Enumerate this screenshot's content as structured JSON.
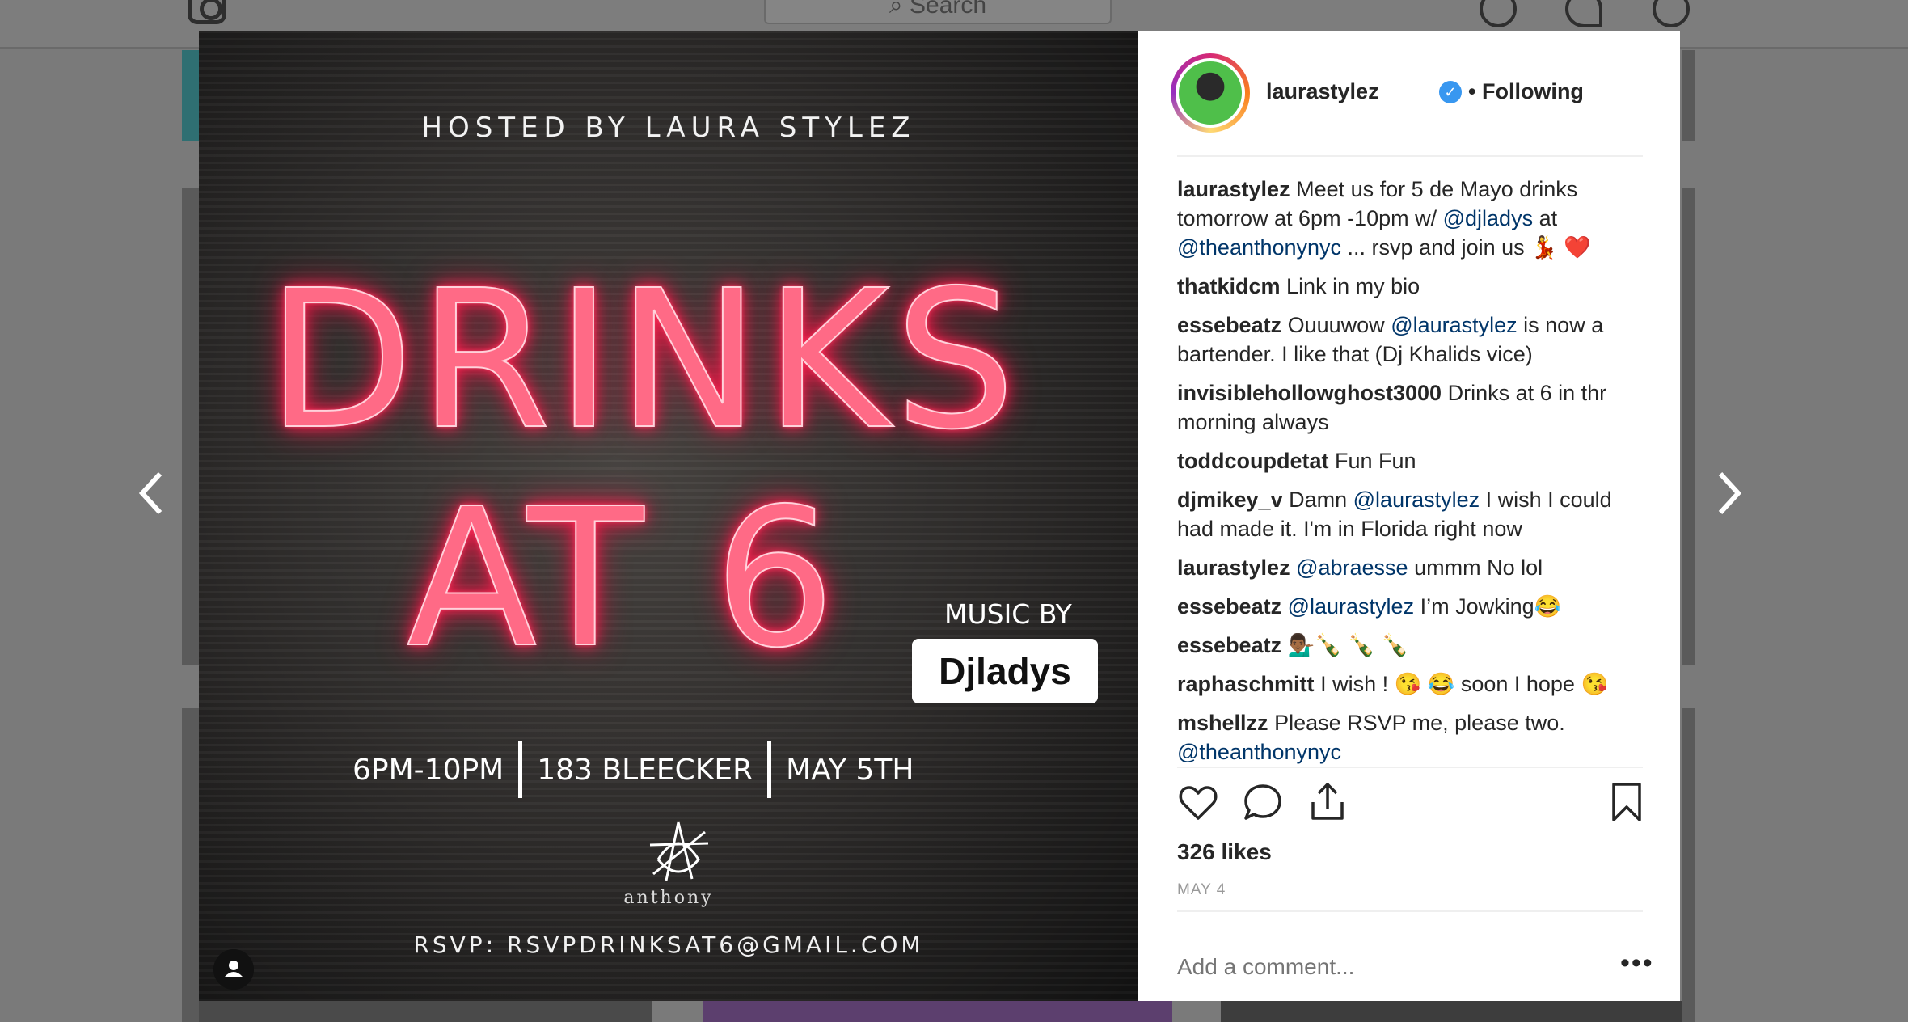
{
  "background": {
    "search_placeholder": "Search"
  },
  "post": {
    "image": {
      "hosted": "HOSTED BY LAURA STYLEZ",
      "headline_line1": "DRINKS",
      "headline_line2": "AT 6",
      "music_by": "MUSIC BY",
      "dj": "Djladys",
      "time": "6PM-10PM",
      "address": "183 BLEECKER",
      "date": "MAY 5TH",
      "venue_logo_text": "anthony",
      "rsvp": "RSVP: RSVPDRINKSAT6@GMAIL.COM"
    },
    "header": {
      "username": "laurastylez",
      "verified_glyph": "✓",
      "following": "• Following"
    },
    "comments": [
      {
        "user": "laurastylez",
        "parts": [
          {
            "t": "Meet us for 5 de Mayo drinks tomorrow at 6pm -10pm w/ "
          },
          {
            "t": "@djladys",
            "mention": true
          },
          {
            "t": " at "
          },
          {
            "t": "@theanthonynyc",
            "mention": true
          },
          {
            "t": " ... rsvp and join us 💃 ❤️"
          }
        ]
      },
      {
        "user": "thatkidcm",
        "parts": [
          {
            "t": "Link in my bio"
          }
        ]
      },
      {
        "user": "essebeatz",
        "parts": [
          {
            "t": "Ouuuwow "
          },
          {
            "t": "@laurastylez",
            "mention": true
          },
          {
            "t": " is now a bartender. I like that (Dj Khalids vice)"
          }
        ]
      },
      {
        "user": "invisiblehollowghost3000",
        "parts": [
          {
            "t": "Drinks at 6 in thr morning always"
          }
        ]
      },
      {
        "user": "toddcoupdetat",
        "parts": [
          {
            "t": "Fun Fun"
          }
        ]
      },
      {
        "user": "djmikey_v",
        "parts": [
          {
            "t": "Damn "
          },
          {
            "t": "@laurastylez",
            "mention": true
          },
          {
            "t": " I wish I could had made it. I'm in Florida right now"
          }
        ]
      },
      {
        "user": "laurastylez",
        "parts": [
          {
            "t": "@abraesse",
            "mention": true
          },
          {
            "t": " ummm No lol"
          }
        ]
      },
      {
        "user": "essebeatz",
        "parts": [
          {
            "t": "@laurastylez",
            "mention": true
          },
          {
            "t": " I’m Jowking😂"
          }
        ]
      },
      {
        "user": "essebeatz",
        "parts": [
          {
            "t": "💁🏾‍♂️🍾 🍾 🍾"
          }
        ]
      },
      {
        "user": "raphaschmitt",
        "parts": [
          {
            "t": "I wish ! 😘 😂  soon I hope 😘"
          }
        ]
      },
      {
        "user": "mshellzz",
        "parts": [
          {
            "t": "Please RSVP me, please two. "
          },
          {
            "t": "@theanthonynyc",
            "mention": true
          }
        ]
      }
    ],
    "likes": "326 likes",
    "date": "MAY 4",
    "add_comment_placeholder": "Add a comment...",
    "more_glyph": "•••"
  },
  "colors": {
    "mention": "#003569",
    "neon": "#ff2a55",
    "verified": "#3897f0"
  },
  "icons": {
    "like": "heart-icon",
    "comment": "speech-bubble-icon",
    "share": "share-icon",
    "save": "bookmark-icon",
    "prev": "chevron-left-icon",
    "next": "chevron-right-icon"
  }
}
